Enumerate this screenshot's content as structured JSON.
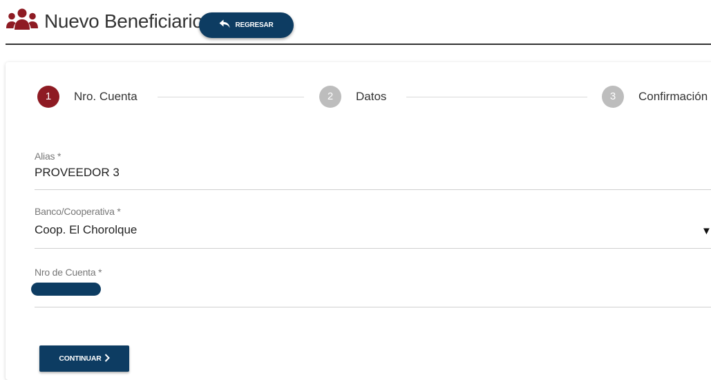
{
  "header": {
    "title": "Nuevo Beneficiario",
    "back_label": "REGRESAR",
    "icon": "users-icon"
  },
  "stepper": {
    "steps": [
      {
        "number": "1",
        "label": "Nro. Cuenta",
        "state": "active"
      },
      {
        "number": "2",
        "label": "Datos",
        "state": "inactive"
      },
      {
        "number": "3",
        "label": "Confirmación",
        "state": "inactive"
      }
    ]
  },
  "form": {
    "alias": {
      "label": "Alias *",
      "value": "PROVEEDOR 3"
    },
    "bank": {
      "label": "Banco/Cooperativa *",
      "value": "Coop. El Chorolque",
      "arrow": "▼"
    },
    "account": {
      "label": "Nro de Cuenta *"
    }
  },
  "actions": {
    "continue_label": "CONTINUAR"
  },
  "colors": {
    "brand_navy": "#0d3c62",
    "active_step": "#8e1b23",
    "inactive_step": "#bdbdbd",
    "icon_red": "#8e1b23"
  }
}
